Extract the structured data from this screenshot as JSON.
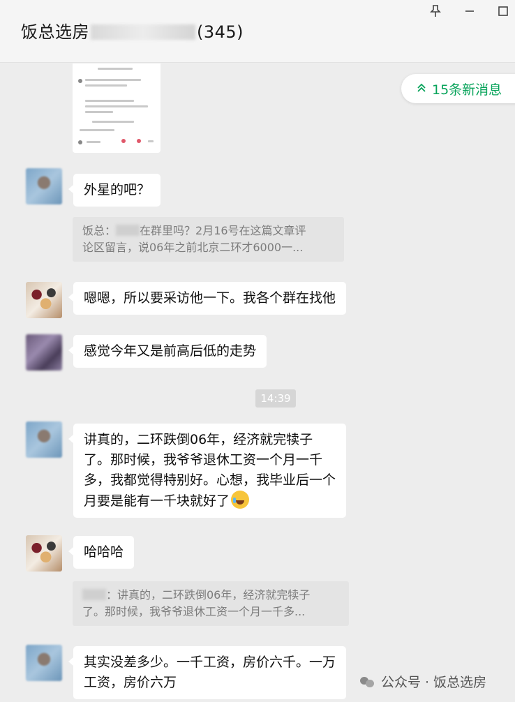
{
  "window": {
    "title_prefix": "饭总选房",
    "title_suffix": "(345)",
    "pin_icon": "pin-icon",
    "minimize_icon": "minimize-icon",
    "maximize_icon": "maximize-icon"
  },
  "new_messages": {
    "label": "15条新消息",
    "icon": "double-chevron-up-icon",
    "color": "#07a35a"
  },
  "messages": [
    {
      "type": "text",
      "text": "外星的吧？"
    },
    {
      "type": "quote",
      "line1_prefix": "饭总：",
      "line1_suffix": "在群里吗？2月16号在这篇文章评",
      "line2": "论区留言，说06年之前北京二环才6000一..."
    },
    {
      "type": "text",
      "text": "嗯嗯，所以要采访他一下。我各个群在找他"
    },
    {
      "type": "text",
      "text": "感觉今年又是前高后低的走势"
    },
    {
      "type": "time",
      "text": "14:39"
    },
    {
      "type": "text",
      "lines": [
        "讲真的，二环跌倒06年，经济就完犊子",
        "了。那时候，我爷爷退休工资一个月一千",
        "多，我都觉得特别好。心想，我毕业后一个",
        "月要是能有一千块就好了"
      ],
      "emoji": "crying-laughing-emoji"
    },
    {
      "type": "text",
      "text": "哈哈哈"
    },
    {
      "type": "quote",
      "line1_suffix": "：讲真的，二环跌倒06年，经济就完犊子",
      "line2": "了。那时候，我爷爷退休工资一个月一千多..."
    },
    {
      "type": "text",
      "lines": [
        "其实没差多少。一千工资，房价六千。一万",
        "工资，房价六万"
      ]
    }
  ],
  "watermark": {
    "text": "公众号 · 饭总选房",
    "icon": "wechat-official-account-icon"
  },
  "colors": {
    "background": "#ededed",
    "bubble": "#ffffff",
    "quote_bg": "#e4e4e4",
    "accent_green": "#07a35a"
  }
}
